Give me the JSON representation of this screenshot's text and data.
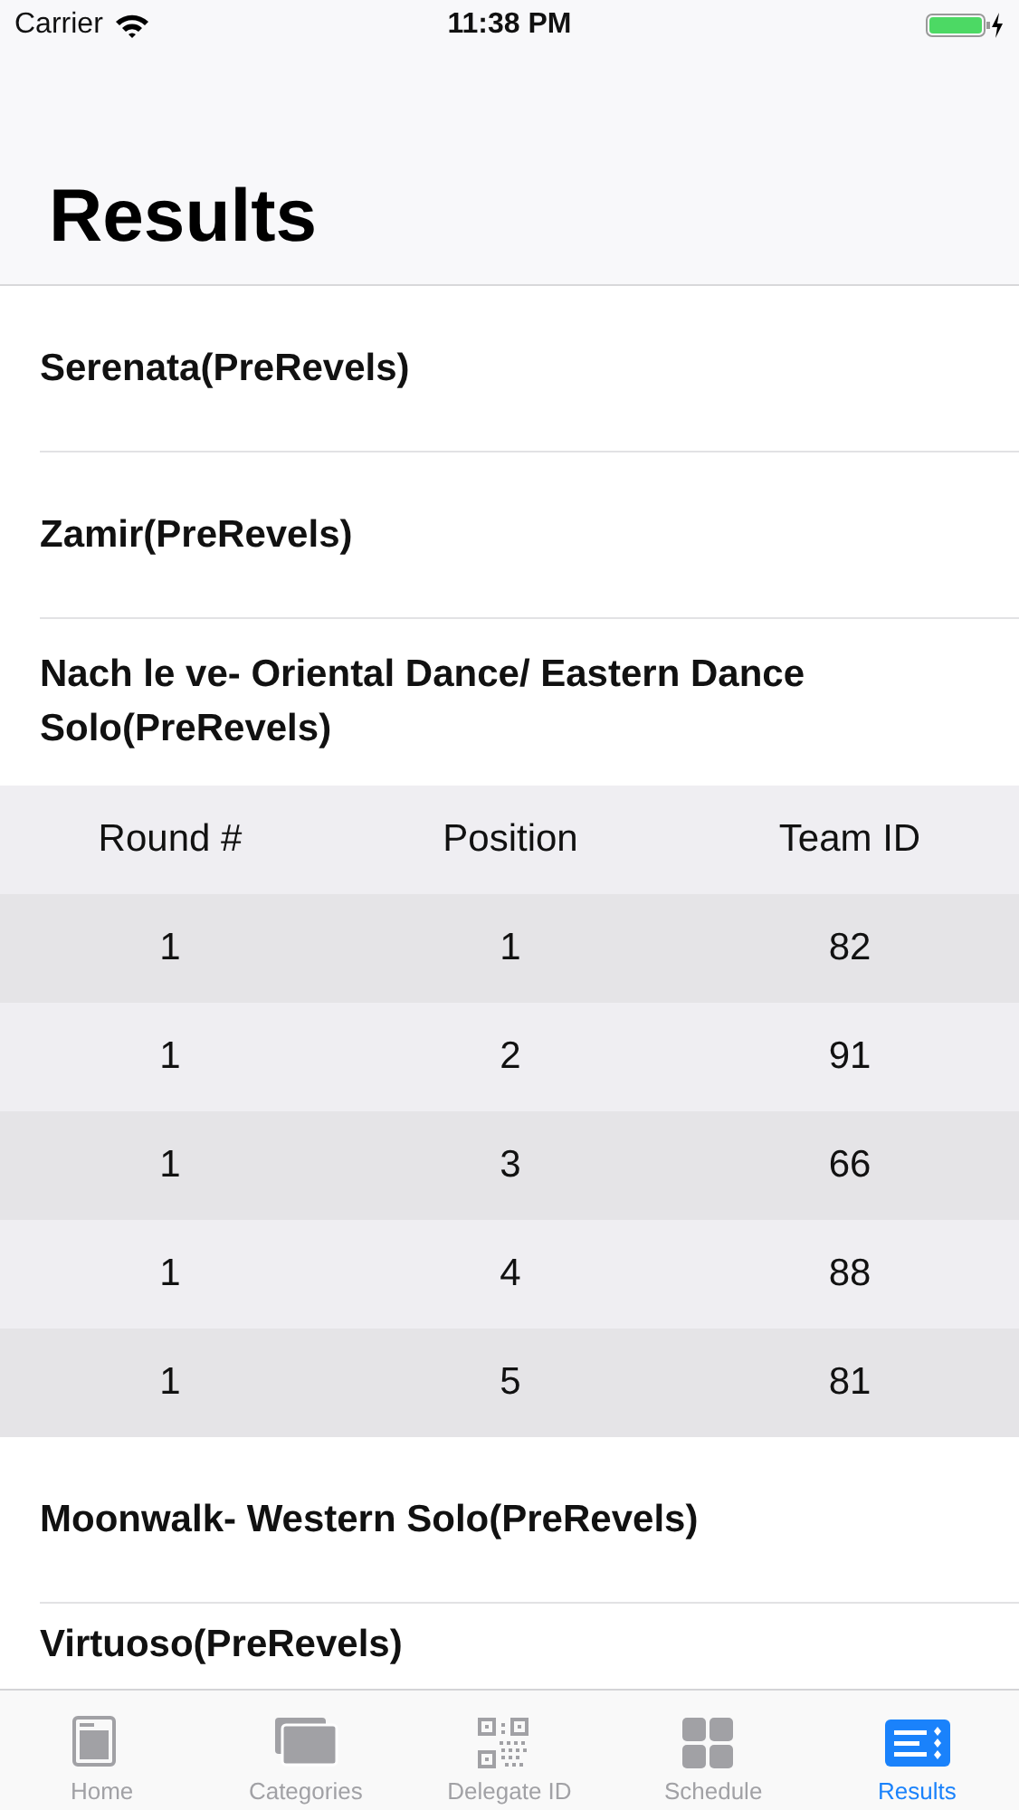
{
  "status_bar": {
    "carrier": "Carrier",
    "time": "11:38 PM"
  },
  "title": "Results",
  "events": [
    {
      "title": "Serenata(PreRevels)"
    },
    {
      "title": "Zamir(PreRevels)"
    },
    {
      "title": "Nach le ve- Oriental Dance/ Eastern Dance Solo(PreRevels)",
      "table": {
        "columns": [
          "Round #",
          "Position",
          "Team ID"
        ],
        "rows": [
          [
            "1",
            "1",
            "82"
          ],
          [
            "1",
            "2",
            "91"
          ],
          [
            "1",
            "3",
            "66"
          ],
          [
            "1",
            "4",
            "88"
          ],
          [
            "1",
            "5",
            "81"
          ]
        ]
      }
    },
    {
      "title": "Moonwalk- Western Solo(PreRevels)"
    },
    {
      "title": "Virtuoso(PreRevels)"
    }
  ],
  "tabs": [
    {
      "kind": "home",
      "label": "Home",
      "selected": false
    },
    {
      "kind": "categories",
      "label": "Categories",
      "selected": false
    },
    {
      "kind": "qr",
      "label": "Delegate ID",
      "selected": false
    },
    {
      "kind": "grid",
      "label": "Schedule",
      "selected": false
    },
    {
      "kind": "list",
      "label": "Results",
      "selected": true
    }
  ]
}
